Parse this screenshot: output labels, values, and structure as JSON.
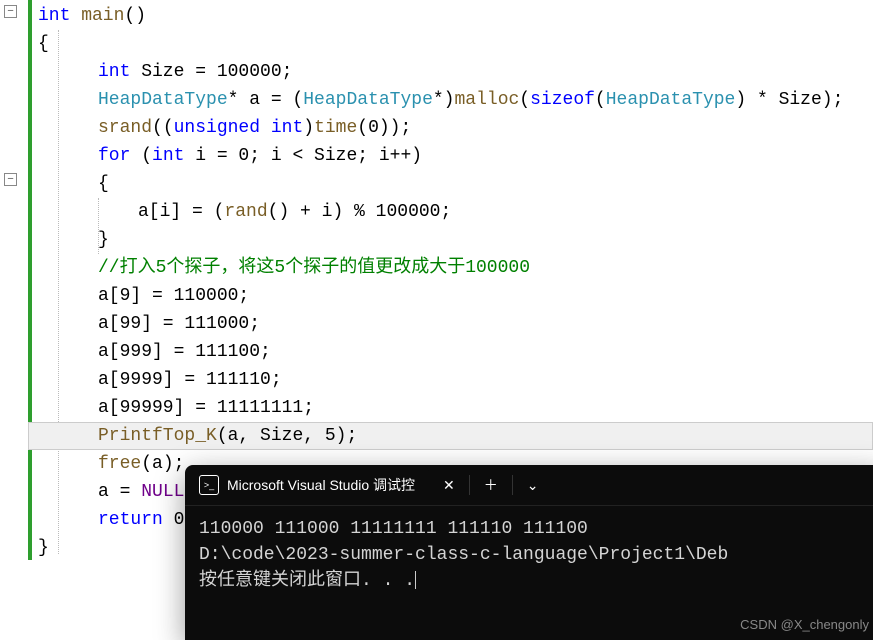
{
  "code": {
    "l1_pre": "int",
    "l1_func": " main",
    "l1_rest": "()",
    "l2": "{",
    "l3_a": "int",
    "l3_b": " Size = 100000;",
    "l4_a": "HeapDataType",
    "l4_b": "* a = (",
    "l4_c": "HeapDataType",
    "l4_d": "*)",
    "l4_e": "malloc",
    "l4_f": "(",
    "l4_g": "sizeof",
    "l4_h": "(",
    "l4_i": "HeapDataType",
    "l4_j": ") * Size);",
    "l5_a": "srand",
    "l5_b": "((",
    "l5_c": "unsigned int",
    "l5_d": ")",
    "l5_e": "time",
    "l5_f": "(0));",
    "l6_a": "for",
    "l6_b": " (",
    "l6_c": "int",
    "l6_d": " i = 0; i < Size; i++)",
    "l7": "{",
    "l8_a": "a[i] = (",
    "l8_b": "rand",
    "l8_c": "() + i) % 100000;",
    "l9": "}",
    "l10": "//打入5个探子，将这5个探子的值更改成大于100000",
    "l11": "a[9] = 110000;",
    "l12": "a[99] = 111000;",
    "l13": "a[999] = 111100;",
    "l14": "a[9999] = 111110;",
    "l15": "a[99999] = 11111111;",
    "l16_a": "PrintfTop_K",
    "l16_b": "(a, Size, 5);",
    "l17_a": "free",
    "l17_b": "(a);",
    "l18_a": "a = ",
    "l18_b": "NULL",
    "l18_c": ";",
    "l19_a": "return",
    "l19_b": " 0;",
    "l20": "}"
  },
  "terminal": {
    "title": "Microsoft Visual Studio 调试控",
    "out1": "110000 111000 11111111 111110 111100",
    "out2": "D:\\code\\2023-summer-class-c-language\\Project1\\Deb",
    "out3": "按任意键关闭此窗口. . .",
    "watermark": "CSDN @X_chengonly"
  }
}
